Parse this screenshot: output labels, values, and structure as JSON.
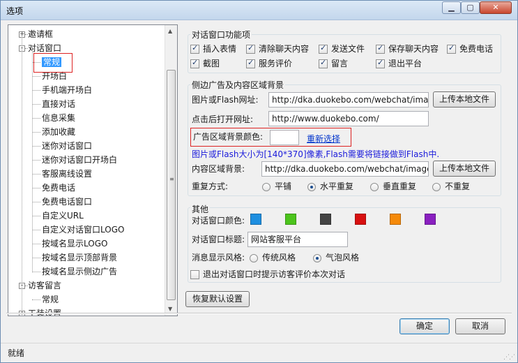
{
  "window": {
    "title": "选项"
  },
  "tree": [
    {
      "label": "邀请框",
      "level": 0,
      "expander": "+"
    },
    {
      "label": "对话窗口",
      "level": 0,
      "expander": "-"
    },
    {
      "label": "常规",
      "level": 1,
      "selected": true
    },
    {
      "label": "开场白",
      "level": 1
    },
    {
      "label": "手机端开场白",
      "level": 1
    },
    {
      "label": "直接对话",
      "level": 1
    },
    {
      "label": "信息采集",
      "level": 1
    },
    {
      "label": "添加收藏",
      "level": 1
    },
    {
      "label": "迷你对话窗口",
      "level": 1
    },
    {
      "label": "迷你对话窗口开场白",
      "level": 1
    },
    {
      "label": "客服离线设置",
      "level": 1
    },
    {
      "label": "免费电话",
      "level": 1
    },
    {
      "label": "免费电话窗口",
      "level": 1
    },
    {
      "label": "自定义URL",
      "level": 1
    },
    {
      "label": "自定义对话窗口LOGO",
      "level": 1
    },
    {
      "label": "按域名显示LOGO",
      "level": 1
    },
    {
      "label": "按域名显示顶部背景",
      "level": 1
    },
    {
      "label": "按域名显示侧边广告",
      "level": 1
    },
    {
      "label": "访客留言",
      "level": 0,
      "expander": "-"
    },
    {
      "label": "常规",
      "level": 1
    },
    {
      "label": "工装设置",
      "level": 0
    }
  ],
  "features": {
    "title": "对话窗口功能项",
    "items": [
      {
        "label": "插入表情",
        "checked": true
      },
      {
        "label": "清除聊天内容",
        "checked": true
      },
      {
        "label": "发送文件",
        "checked": true
      },
      {
        "label": "保存聊天内容",
        "checked": true
      },
      {
        "label": "免费电话",
        "checked": true
      },
      {
        "label": "截图",
        "checked": true
      },
      {
        "label": "服务评价",
        "checked": true
      },
      {
        "label": "留言",
        "checked": true
      },
      {
        "label": "退出平台",
        "checked": true
      }
    ]
  },
  "sidead": {
    "title": "侧边广告及内容区域背景",
    "image_label": "图片或Flash网址:",
    "image_value": "http://dka.duokebo.com/webchat/images/",
    "upload_label": "上传本地文件",
    "click_label": "点击后打开网址:",
    "click_value": "http://www.duokebo.com/",
    "bg_color_label": "广告区域背景颜色:",
    "reselect_label": "重新选择",
    "note": "图片或Flash大小为[140*370]像素,Flash需要将链接做到Flash中.",
    "content_bg_label": "内容区域背景:",
    "content_bg_value": "http://dka.duokebo.com/webchat/images/",
    "upload2_label": "上传本地文件",
    "repeat_label": "重复方式:",
    "repeat_options": [
      {
        "label": "平铺",
        "selected": false
      },
      {
        "label": "水平重复",
        "selected": true
      },
      {
        "label": "垂直重复",
        "selected": false
      },
      {
        "label": "不重复",
        "selected": false
      }
    ]
  },
  "other": {
    "title": "其他",
    "color_label": "对话窗口颜色:",
    "colors": [
      "#1e8fe0",
      "#4cc41c",
      "#444444",
      "#d81010",
      "#f58a0a",
      "#8a20c0"
    ],
    "title_label": "对话窗口标题:",
    "title_value": "网站客服平台",
    "style_label": "消息显示风格:",
    "style_options": [
      {
        "label": "传统风格",
        "selected": false
      },
      {
        "label": "气泡风格",
        "selected": true
      }
    ],
    "exit_prompt_label": "退出对话窗口时提示访客评价本次对话",
    "exit_prompt_checked": false
  },
  "buttons": {
    "restore": "恢复默认设置",
    "ok": "确定",
    "cancel": "取消"
  },
  "status": {
    "text": "就绪"
  }
}
